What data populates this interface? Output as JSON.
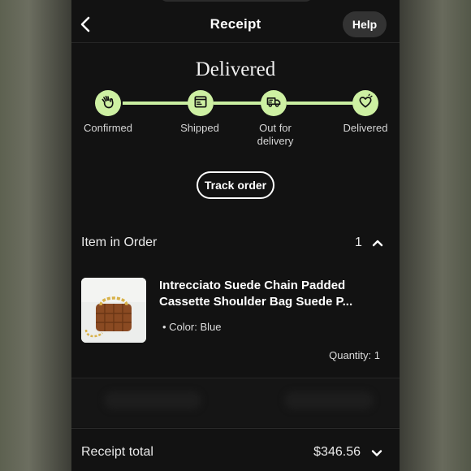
{
  "header": {
    "title": "Receipt",
    "help_label": "Help",
    "back_icon": "chevron-left-icon"
  },
  "status": {
    "heading": "Delivered",
    "accent_color": "#cdf0a2",
    "steps": [
      {
        "label": "Confirmed",
        "icon": "waving-hand-icon"
      },
      {
        "label": "Shipped",
        "icon": "package-icon"
      },
      {
        "label_line1": "Out for",
        "label_line2": "delivery",
        "icon": "delivery-truck-icon"
      },
      {
        "label": "Delivered",
        "icon": "heart-box-icon"
      }
    ]
  },
  "track_order_label": "Track order",
  "items_section": {
    "title": "Item in Order",
    "count": "1",
    "item": {
      "title_line1": "Intrecciato Suede Chain Padded",
      "title_line2": "Cassette Shoulder Bag Suede P...",
      "option": "Color: Blue",
      "quantity": "Quantity: 1"
    }
  },
  "receipt_total": {
    "label": "Receipt total",
    "amount": "$346.56"
  }
}
